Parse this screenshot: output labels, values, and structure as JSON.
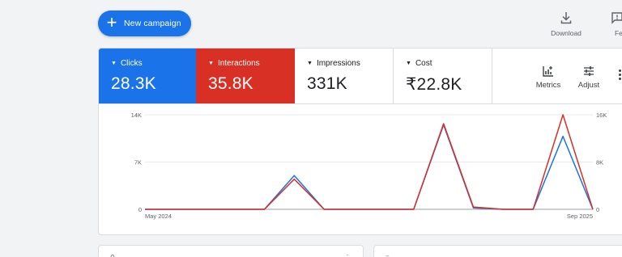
{
  "toolbar": {
    "new_campaign_label": "New campaign",
    "download_label": "Download",
    "feedback_label": "Feedb"
  },
  "metric_tiles": [
    {
      "name": "Clicks",
      "value": "28.3K",
      "color": "#1a73e8"
    },
    {
      "name": "Interactions",
      "value": "35.8K",
      "color": "#d93025"
    },
    {
      "name": "Impressions",
      "value": "331K"
    },
    {
      "name": "Cost",
      "value": "₹22.8K"
    }
  ],
  "chart_tools": {
    "metrics_label": "Metrics",
    "adjust_label": "Adjust"
  },
  "chart_data": {
    "type": "line",
    "x_start_label": "May 2024",
    "x_end_label": "Sep 2025",
    "left_axis": {
      "ticks": [
        "14K",
        "7K",
        "0"
      ],
      "range": [
        0,
        14000
      ]
    },
    "right_axis": {
      "ticks": [
        "16K",
        "8K",
        "0"
      ],
      "range": [
        0,
        16000
      ]
    },
    "grid": true,
    "series": [
      {
        "name": "Clicks",
        "color": "#1a73e8",
        "axis": "left",
        "values": [
          0,
          0,
          0,
          0,
          0,
          5000,
          0,
          0,
          0,
          0,
          12500,
          200,
          0,
          0,
          10800,
          0
        ]
      },
      {
        "name": "Interactions",
        "color": "#d93025",
        "axis": "right",
        "values": [
          0,
          0,
          0,
          0,
          0,
          5100,
          0,
          0,
          0,
          0,
          14500,
          400,
          0,
          0,
          16000,
          0
        ]
      }
    ]
  }
}
